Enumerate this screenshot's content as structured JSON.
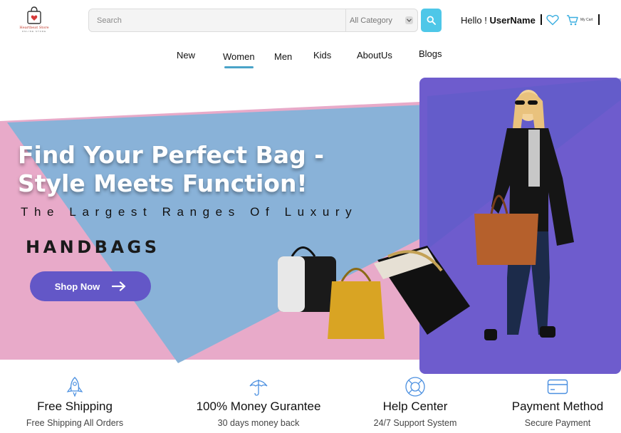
{
  "header": {
    "logo": {
      "name": "Heartbeat Store",
      "tagline": "ONLINE STORE"
    },
    "search": {
      "placeholder": "Search",
      "category": "All Category"
    },
    "greeting": {
      "prefix": "Hello !",
      "username": "UserName"
    },
    "cart_label": "My Cart",
    "icons": [
      "search-icon",
      "heart-icon",
      "cart-icon",
      "chevron-down-icon"
    ]
  },
  "nav": {
    "items": [
      "New",
      "Women",
      "Men",
      "Kids",
      "AboutUs",
      "Blogs"
    ],
    "active": "Women",
    "accent": "#4aa3c8"
  },
  "hero": {
    "title": "Find Your Perfect Bag - Style Meets Function!",
    "subtitle": "The Largest Ranges Of Luxury",
    "highlight": "HANDBAGS",
    "cta_label": "Shop Now",
    "colors": {
      "pink": "#e8aac9",
      "blue": "#89b2d8",
      "purple": "#6f5fcf",
      "button": "#6357c7"
    }
  },
  "features": [
    {
      "title": "Free Shipping",
      "subtitle": "Free Shipping All Orders",
      "icon": "rocket-icon"
    },
    {
      "title": "100% Money Gurantee",
      "subtitle": "30 days money back",
      "icon": "umbrella-icon"
    },
    {
      "title": "Help Center",
      "subtitle": "24/7 Support System",
      "icon": "lifebuoy-icon"
    },
    {
      "title": "Payment Method",
      "subtitle": "Secure Payment",
      "icon": "credit-card-icon"
    }
  ]
}
